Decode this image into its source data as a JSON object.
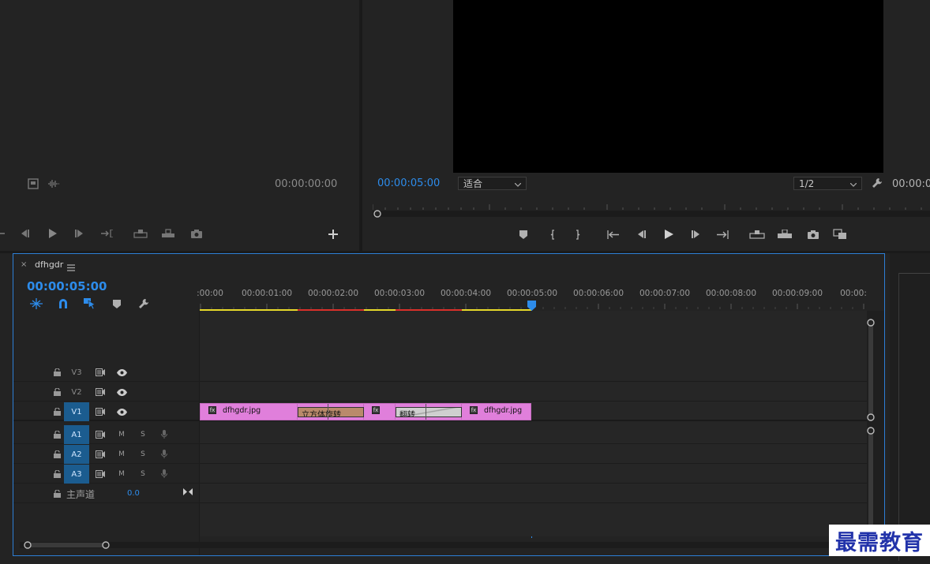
{
  "source": {
    "timecode": "00:00:00:00"
  },
  "program": {
    "timecode": "00:00:05:00",
    "fit_label": "适合",
    "resolution": "1/2",
    "end_timecode": "00:00:0"
  },
  "timeline": {
    "sequence_name": "dfhgdr",
    "playhead_timecode": "00:00:05:00",
    "ruler_labels": [
      ":00:00",
      "00:00:01:00",
      "00:00:02:00",
      "00:00:03:00",
      "00:00:04:00",
      "00:00:05:00",
      "00:00:06:00",
      "00:00:07:00",
      "00:00:08:00",
      "00:00:09:00",
      "00:00:"
    ],
    "video_tracks": [
      {
        "label": "V3"
      },
      {
        "label": "V2"
      },
      {
        "label": "V1"
      }
    ],
    "audio_tracks": [
      {
        "label": "A1",
        "mute": "M",
        "solo": "S"
      },
      {
        "label": "A2",
        "mute": "M",
        "solo": "S"
      },
      {
        "label": "A3",
        "mute": "M",
        "solo": "S"
      }
    ],
    "master": {
      "label": "主声道",
      "value": "0.0"
    },
    "clips": {
      "clip1_name": "dfhgdr.jpg",
      "clip1_fx": "fx",
      "transition1": "立方体旋转",
      "clip2_fx": "fx",
      "transition2": "翻转",
      "clip3_fx": "fx",
      "clip3_name": "dfhgdr.jpg"
    }
  },
  "watermark": "最需教育",
  "colors": {
    "accent": "#2d8ceb",
    "clip": "#e07fdb",
    "render_yellow": "#e6d82a",
    "render_red": "#d9302a"
  }
}
